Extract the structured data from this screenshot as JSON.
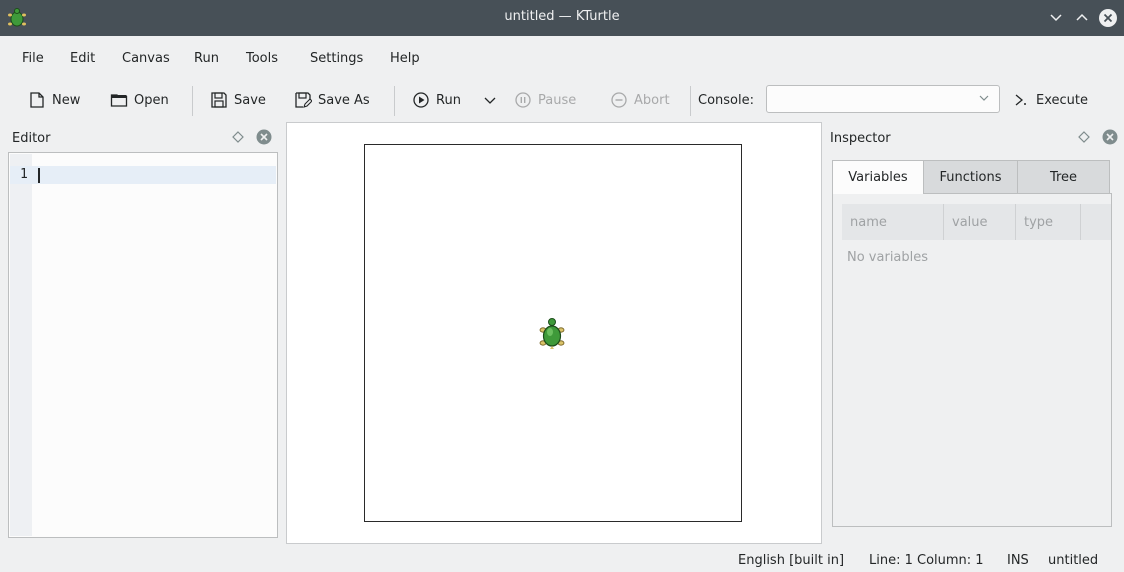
{
  "window": {
    "title": "untitled — KTurtle",
    "icon": "kturtle-app-icon",
    "buttons": [
      "minimize-icon",
      "maximize-icon",
      "close-icon"
    ]
  },
  "menu": {
    "items": [
      "File",
      "Edit",
      "Canvas",
      "Run",
      "Tools",
      "Settings",
      "Help"
    ]
  },
  "toolbar": {
    "new_label": "New",
    "open_label": "Open",
    "save_label": "Save",
    "saveas_label": "Save As",
    "run_label": "Run",
    "pause_label": "Pause",
    "abort_label": "Abort",
    "console_label": "Console:",
    "console_value": "",
    "execute_label": "Execute"
  },
  "editor": {
    "title": "Editor",
    "line_numbers": [
      "1"
    ]
  },
  "inspector": {
    "title": "Inspector",
    "tabs": [
      "Variables",
      "Functions",
      "Tree"
    ],
    "active_tab": "Variables",
    "columns": [
      "name",
      "value",
      "type"
    ],
    "empty_text": "No variables"
  },
  "status": {
    "language": "English [built in]",
    "position": "Line: 1 Column: 1",
    "mode": "INS",
    "file": "untitled"
  },
  "colors": {
    "titlebar": "#475057",
    "window_bg": "#eff0f1",
    "turtle_green": "#3f9a3a"
  }
}
